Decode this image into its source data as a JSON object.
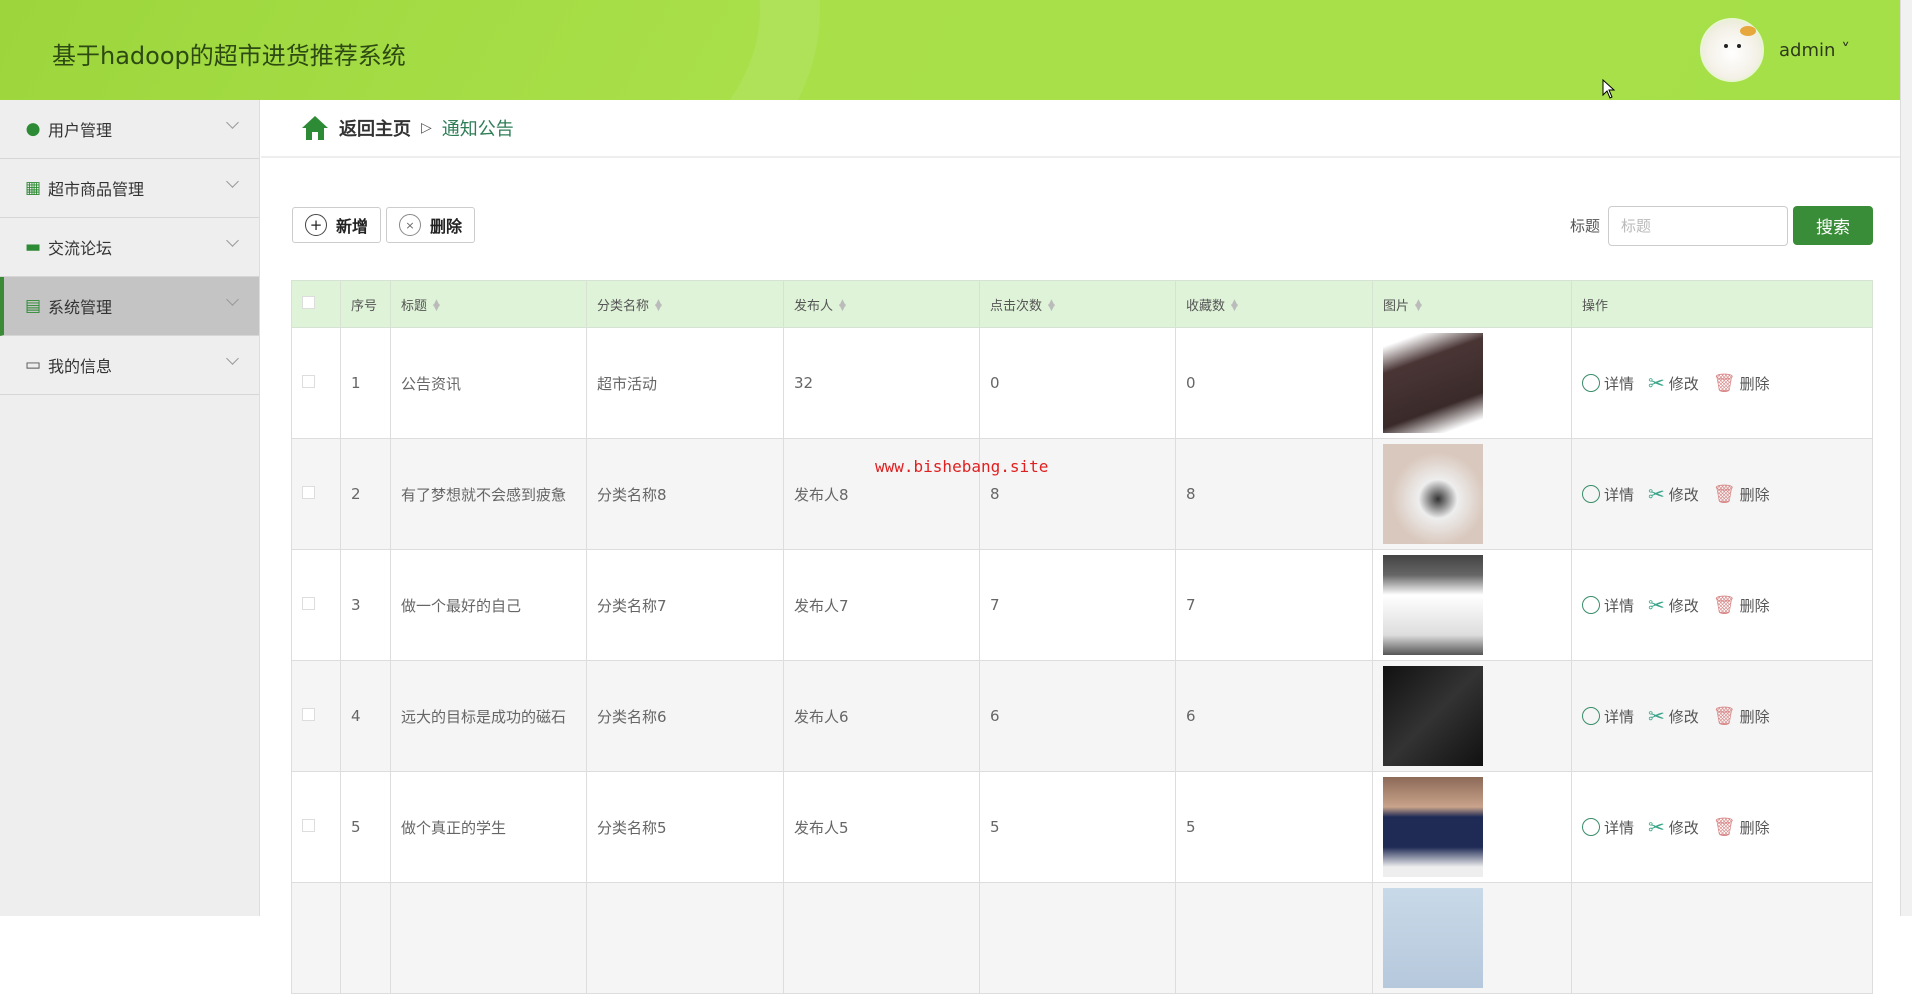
{
  "header": {
    "title": "基于hadoop的超市进货推荐系统",
    "user": "admin ˅"
  },
  "sidebar": {
    "items": [
      {
        "label": "用户管理",
        "icon": "bulb-icon"
      },
      {
        "label": "超市商品管理",
        "icon": "grid-icon"
      },
      {
        "label": "交流论坛",
        "icon": "briefcase-icon"
      },
      {
        "label": "系统管理",
        "icon": "clipboard-icon"
      },
      {
        "label": "我的信息",
        "icon": "card-icon"
      }
    ]
  },
  "breadcrumb": {
    "home": "返回主页",
    "sep": "▷",
    "current": "通知公告"
  },
  "toolbar": {
    "add": "新增",
    "delete": "删除",
    "search_label": "标题",
    "search_placeholder": "标题",
    "search_button": "搜索"
  },
  "table": {
    "headers": [
      "序号",
      "标题",
      "分类名称",
      "发布人",
      "点击次数",
      "收藏数",
      "图片",
      "操作"
    ],
    "rows": [
      {
        "no": "1",
        "title": "公告资讯",
        "category": "超市活动",
        "publisher": "32",
        "clicks": "0",
        "favs": "0"
      },
      {
        "no": "2",
        "title": "有了梦想就不会感到疲惫",
        "category": "分类名称8",
        "publisher": "发布人8",
        "clicks": "8",
        "favs": "8"
      },
      {
        "no": "3",
        "title": "做一个最好的自己",
        "category": "分类名称7",
        "publisher": "发布人7",
        "clicks": "7",
        "favs": "7"
      },
      {
        "no": "4",
        "title": "远大的目标是成功的磁石",
        "category": "分类名称6",
        "publisher": "发布人6",
        "clicks": "6",
        "favs": "6"
      },
      {
        "no": "5",
        "title": "做个真正的学生",
        "category": "分类名称5",
        "publisher": "发布人5",
        "clicks": "5",
        "favs": "5"
      },
      {
        "no": "",
        "title": "",
        "category": "",
        "publisher": "",
        "clicks": "",
        "favs": ""
      }
    ],
    "ops": {
      "detail": "详情",
      "edit": "修改",
      "delete": "删除"
    }
  },
  "watermark": "www.bishebang.site",
  "colors": {
    "header": "#a6e048",
    "accent": "#3a8d38",
    "table_header": "#dff3d9"
  }
}
